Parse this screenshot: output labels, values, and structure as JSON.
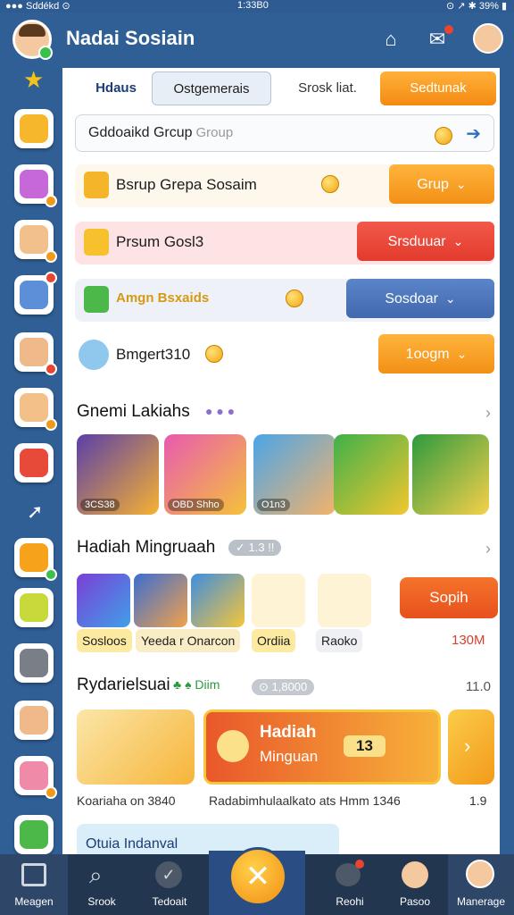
{
  "status": {
    "left": "●●● Sddékd ⊙",
    "center": "1:33B0",
    "right": "⊙ ↗ ✱ 39% ▮"
  },
  "header": {
    "title": "Nadai Sosiain"
  },
  "tabs": {
    "active": "Hdaus",
    "a": "Ostgemerais",
    "b": "Srosk liat.",
    "c": "Sedtunak"
  },
  "search": {
    "value": "Gddoaikd Grcup",
    "placeholder": "Group"
  },
  "rows": [
    {
      "label": "Bsrup Grepa Sosaim",
      "button": "Grup",
      "color": "#f7a21b"
    },
    {
      "label": "Prsum Gosl3",
      "button": "Srsduuar",
      "color": "#ec4b3d"
    },
    {
      "label": "Amgn Bsxaids",
      "button": "Sosdoar",
      "color": "#4b75bd"
    },
    {
      "label": "Bmgert310",
      "button": "1oogm",
      "color": "#f7a21b"
    }
  ],
  "section1": {
    "title": "Gnemi Lakiahs",
    "tiles": [
      "3CS38",
      "OBD Shho",
      "O1n3",
      "",
      ""
    ]
  },
  "section2": {
    "title": "Hadiah Mingruaah",
    "badge": "✓ 1.3 !!",
    "action": "Sopih",
    "price": "130M",
    "chips": [
      "Sosloos",
      "Yeeda r Onarcon",
      "Ordiia",
      "Raoko"
    ]
  },
  "section3": {
    "title": "Rydarielsuai",
    "meta": "Diim",
    "count": "⊙ 1,8000",
    "right": "11.0",
    "promo": {
      "line1": "Hadiah",
      "line2": "Minguan",
      "value": "13"
    },
    "captions": {
      "left": "Koariaha on 3840",
      "mid": "Radabimhulaalkato ats Hmm 1346",
      "right": "1.9"
    }
  },
  "bottom_card": {
    "label": "Otuia Indanval"
  },
  "nav": {
    "items": [
      "Meagen",
      "Srook",
      "Tedoait",
      "",
      "Reohi",
      "Pasoo",
      "Manerage"
    ]
  },
  "colors": {
    "primary": "#2f5f95",
    "accent": "#f7a21b",
    "danger": "#ec4b3d",
    "nav_bg": "#23364f"
  }
}
